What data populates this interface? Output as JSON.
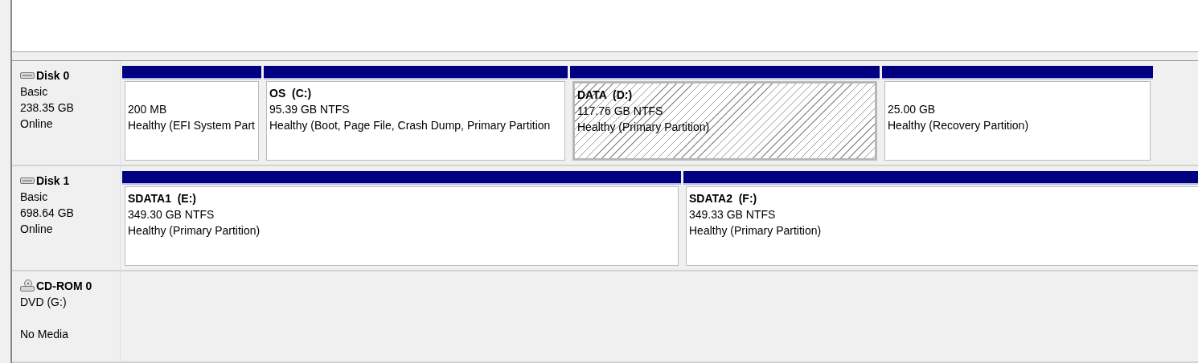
{
  "disks": [
    {
      "kind": "disk",
      "name": "Disk 0",
      "type": "Basic",
      "size": "238.35 GB",
      "status": "Online",
      "partitions": [
        {
          "size": "200 MB",
          "status": "Healthy (EFI System Part",
          "selected": false
        },
        {
          "name": "OS  (C:)",
          "size": "95.39 GB NTFS",
          "status": "Healthy (Boot, Page File, Crash Dump, Primary Partition",
          "selected": false
        },
        {
          "name": "DATA  (D:)",
          "size": "117.76 GB NTFS",
          "status": "Healthy (Primary Partition)",
          "selected": true
        },
        {
          "size": "25.00 GB",
          "status": "Healthy (Recovery Partition)",
          "selected": false
        }
      ]
    },
    {
      "kind": "disk",
      "name": "Disk 1",
      "type": "Basic",
      "size": "698.64 GB",
      "status": "Online",
      "partitions": [
        {
          "name": "SDATA1  (E:)",
          "size": "349.30 GB NTFS",
          "status": "Healthy (Primary Partition)",
          "selected": false
        },
        {
          "name": "SDATA2  (F:)",
          "size": "349.33 GB NTFS",
          "status": "Healthy (Primary Partition)",
          "selected": false
        }
      ]
    },
    {
      "kind": "cdrom",
      "name": "CD-ROM 0",
      "type": "DVD (G:)",
      "status": "No Media"
    }
  ]
}
